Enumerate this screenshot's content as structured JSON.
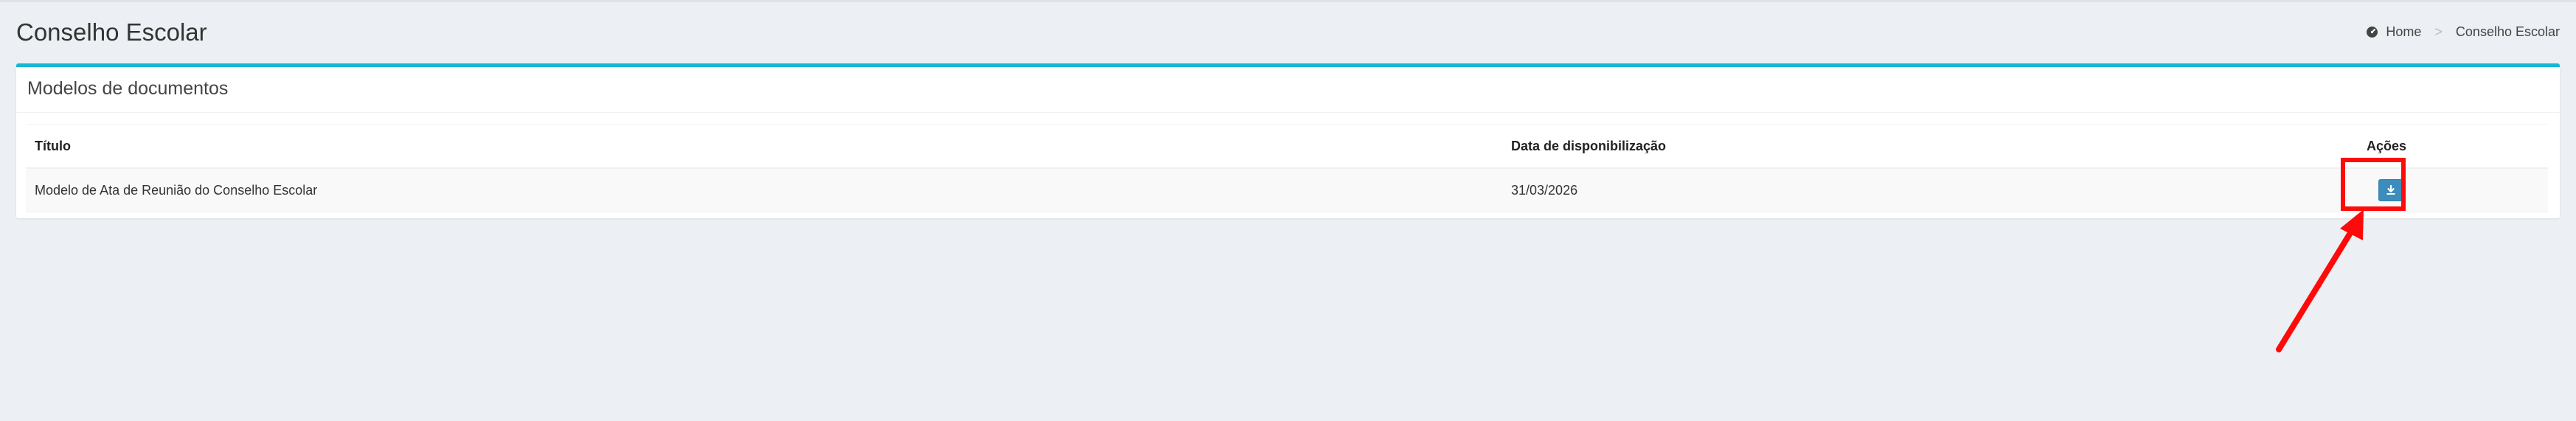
{
  "page": {
    "title": "Conselho Escolar"
  },
  "breadcrumb": {
    "home": "Home",
    "current": "Conselho Escolar"
  },
  "card": {
    "title": "Modelos de documentos",
    "accent_color": "#17b8d6"
  },
  "table": {
    "headers": {
      "title": "Título",
      "date": "Data de disponibilização",
      "actions": "Ações"
    },
    "rows": [
      {
        "title": "Modelo de Ata de Reunião do Conselho Escolar",
        "date": "31/03/2026",
        "action_icon": "download-icon"
      }
    ]
  },
  "annotation": {
    "color": "#ff0a0a"
  }
}
